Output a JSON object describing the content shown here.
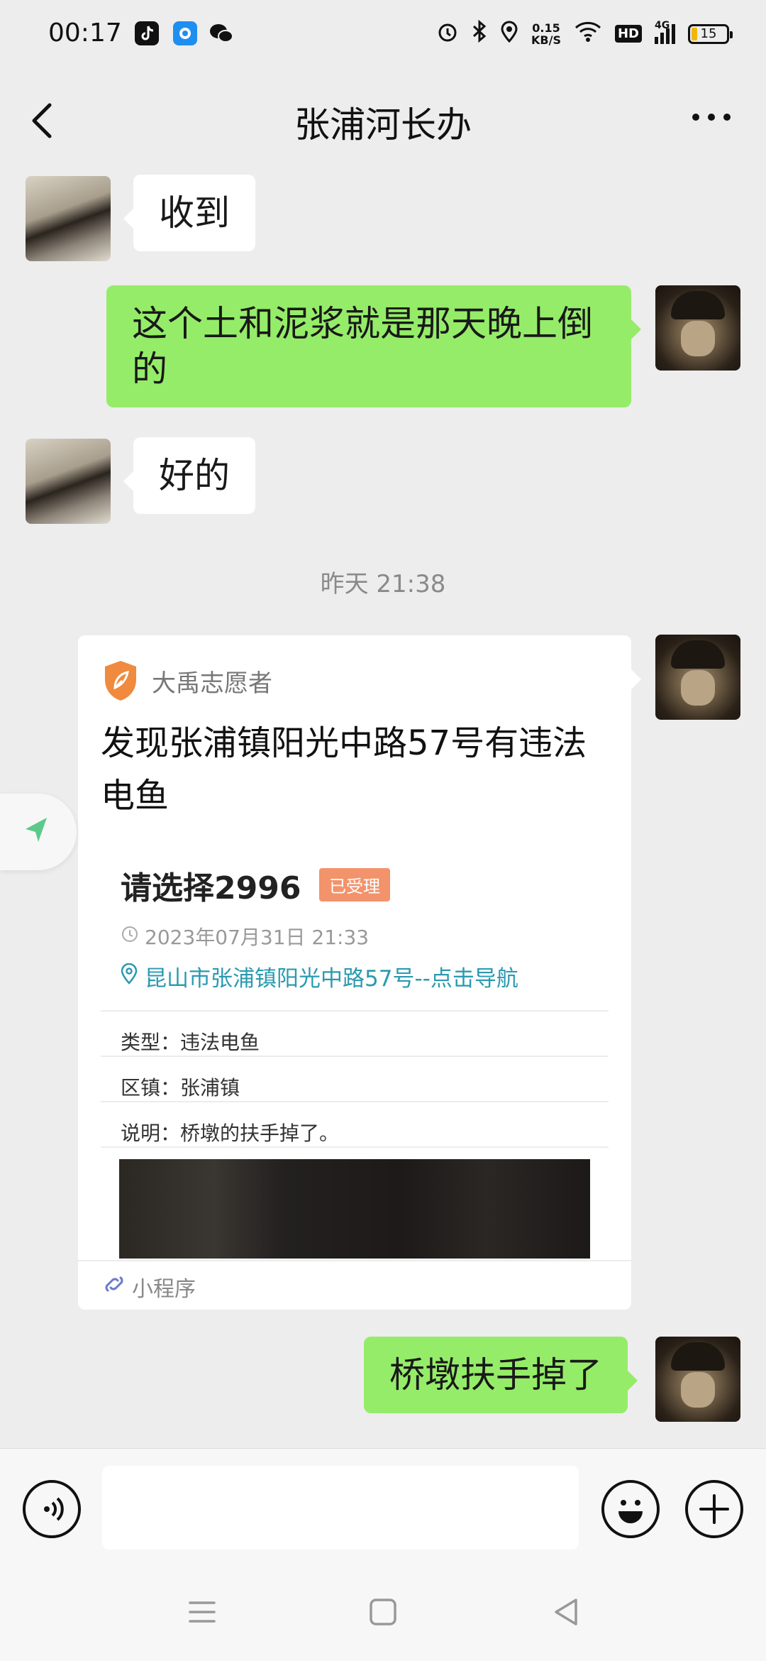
{
  "status_bar": {
    "time": "00:17",
    "speed_value": "0.15",
    "speed_unit": "KB/S",
    "network": "4G",
    "hd": "HD",
    "battery": "15"
  },
  "nav": {
    "title": "张浦河长办"
  },
  "messages": [
    {
      "side": "in",
      "text": "收到"
    },
    {
      "side": "out",
      "text": "这个土和泥浆就是那天晚上倒的"
    },
    {
      "side": "in",
      "text": "好的"
    },
    {
      "side": "out",
      "text": "桥墩扶手掉了"
    }
  ],
  "timestamp": "昨天 21:38",
  "card": {
    "source": "大禹志愿者",
    "title": "发现张浦镇阳光中路57号有违法电鱼",
    "name": "请选择2996",
    "badge": "已受理",
    "time": "2023年07月31日 21:33",
    "address": "昆山市张浦镇阳光中路57号--点击导航",
    "rows": [
      {
        "text": "类型：违法电鱼"
      },
      {
        "text": "区镇：张浦镇"
      },
      {
        "text": "说明：桥墩的扶手掉了。"
      }
    ],
    "footer": "小程序",
    "accent_color": "#f08a3e",
    "link_color": "#2a9ab0"
  },
  "colors": {
    "outgoing_bubble": "#95ec69",
    "incoming_bubble": "#ffffff",
    "background": "#ededed"
  }
}
